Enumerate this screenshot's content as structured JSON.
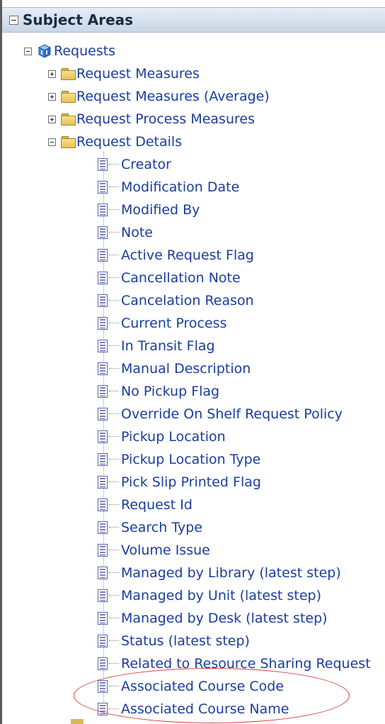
{
  "header": {
    "title": "Subject Areas"
  },
  "tree": {
    "root": {
      "label": "Requests"
    },
    "folders": [
      {
        "label": "Request Measures",
        "expanded": false
      },
      {
        "label": "Request Measures (Average)",
        "expanded": false
      },
      {
        "label": "Request Process Measures",
        "expanded": false
      },
      {
        "label": "Request Details",
        "expanded": true
      }
    ],
    "columns": [
      "Creator",
      "Modification Date",
      "Modified By",
      "Note",
      "Active Request Flag",
      "Cancellation Note",
      "Cancelation Reason",
      "Current Process",
      "In Transit Flag",
      "Manual Description",
      "No Pickup Flag",
      "Override On Shelf Request Policy",
      "Pickup Location",
      "Pickup Location Type",
      "Pick Slip Printed Flag",
      "Request Id",
      "Search Type",
      "Volume Issue",
      "Managed by Library (latest step)",
      "Managed by Unit (latest step)",
      "Managed by Desk (latest step)",
      "Status (latest step)",
      "Related to Resource Sharing Request",
      "Associated Course Code",
      "Associated Course Name"
    ]
  },
  "colors": {
    "label": "#1a3d9e",
    "highlight": "#d23a3a",
    "header_bg": "#c9d6e6"
  }
}
